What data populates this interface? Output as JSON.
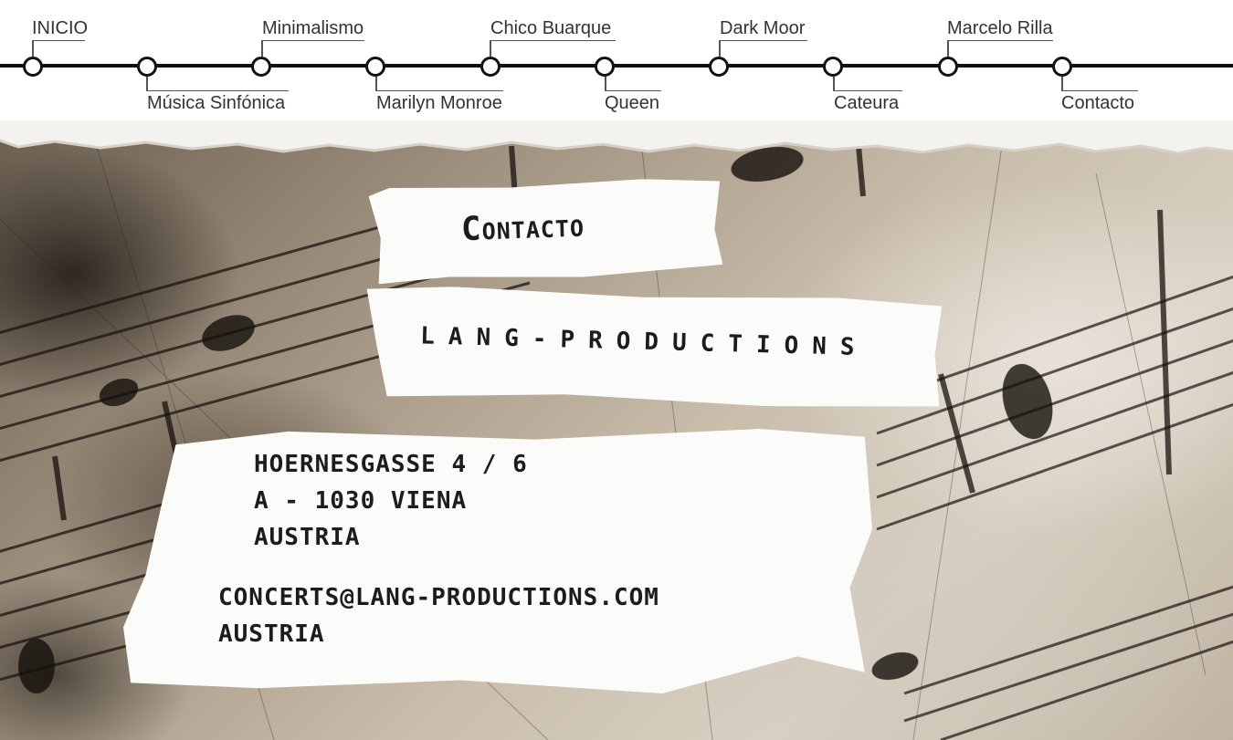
{
  "nav": {
    "items": [
      {
        "label": "INICIO",
        "pos": "up"
      },
      {
        "label": "Música Sinfónica",
        "pos": "down"
      },
      {
        "label": "Minimalismo",
        "pos": "up"
      },
      {
        "label": "Marilyn Monroe",
        "pos": "down"
      },
      {
        "label": "Chico Buarque",
        "pos": "up"
      },
      {
        "label": "Queen",
        "pos": "down"
      },
      {
        "label": "Dark Moor",
        "pos": "up"
      },
      {
        "label": "Cateura",
        "pos": "down"
      },
      {
        "label": "Marcelo Rilla",
        "pos": "up"
      },
      {
        "label": "Contacto",
        "pos": "down"
      }
    ]
  },
  "content": {
    "title": "Contacto",
    "brand": "LANG-PRODUCTIONS",
    "address": {
      "street": "HOERNESGASSE 4 / 6",
      "city": "A - 1030  VIENA",
      "country": "AUSTRIA"
    },
    "email": "CONCERTS@LANG-PRODUCTIONS.COM",
    "email_country": "AUSTRIA"
  },
  "colors": {
    "track": "#111111",
    "paper": "#fbfbf9",
    "ink": "#1c1c1c"
  }
}
